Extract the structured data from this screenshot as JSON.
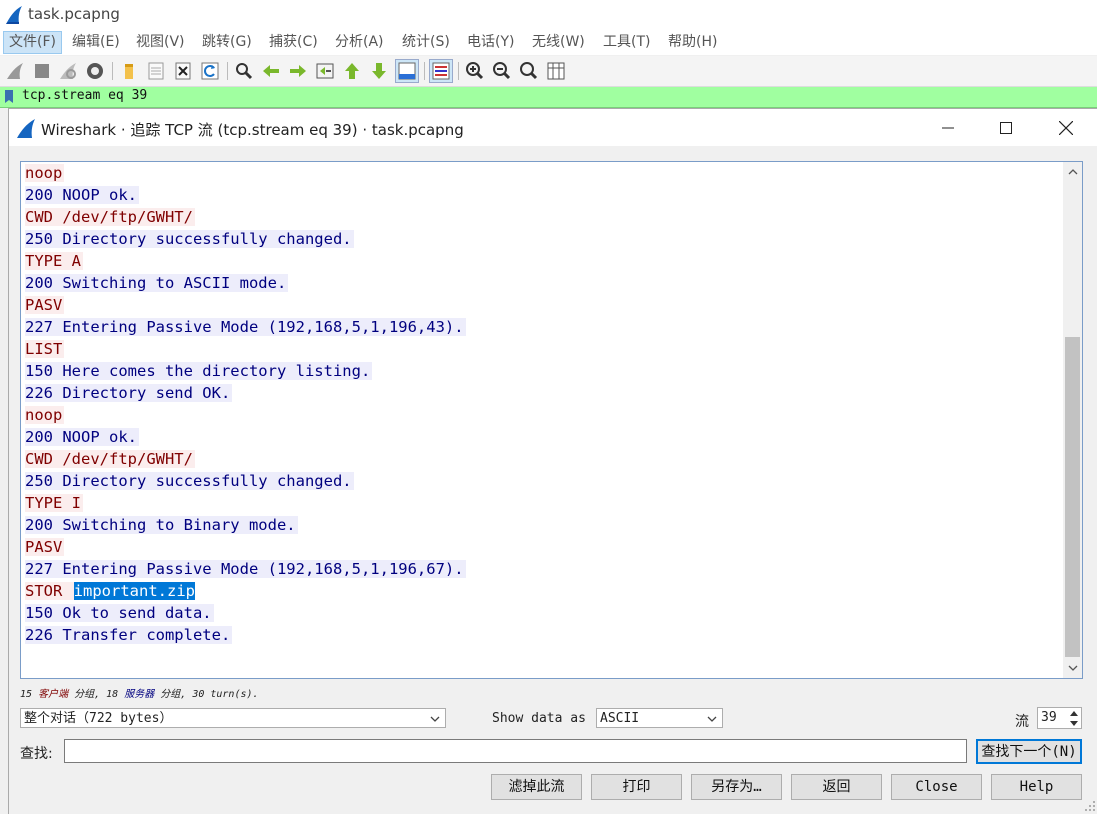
{
  "app": {
    "file_title": "task.pcapng",
    "menu": [
      "文件(F)",
      "编辑(E)",
      "视图(V)",
      "跳转(G)",
      "捕获(C)",
      "分析(A)",
      "统计(S)",
      "电话(Y)",
      "无线(W)",
      "工具(T)",
      "帮助(H)"
    ],
    "display_filter": "tcp.stream eq 39"
  },
  "dialog": {
    "title": "Wireshark · 追踪 TCP 流 (tcp.stream eq 39) · task.pcapng",
    "lines": [
      {
        "dir": "client",
        "text": "noop"
      },
      {
        "dir": "server",
        "text": "200 NOOP ok."
      },
      {
        "dir": "client",
        "text": "CWD /dev/ftp/GWHT/"
      },
      {
        "dir": "server",
        "text": "250 Directory successfully changed."
      },
      {
        "dir": "client",
        "text": "TYPE A"
      },
      {
        "dir": "server",
        "text": "200 Switching to ASCII mode."
      },
      {
        "dir": "client",
        "text": "PASV"
      },
      {
        "dir": "server",
        "text": "227 Entering Passive Mode (192,168,5,1,196,43)."
      },
      {
        "dir": "client",
        "text": "LIST"
      },
      {
        "dir": "server",
        "text": "150 Here comes the directory listing."
      },
      {
        "dir": "server",
        "text": "226 Directory send OK."
      },
      {
        "dir": "client",
        "text": "noop"
      },
      {
        "dir": "server",
        "text": "200 NOOP ok."
      },
      {
        "dir": "client",
        "text": "CWD /dev/ftp/GWHT/"
      },
      {
        "dir": "server",
        "text": "250 Directory successfully changed."
      },
      {
        "dir": "client",
        "text": "TYPE I"
      },
      {
        "dir": "server",
        "text": "200 Switching to Binary mode."
      },
      {
        "dir": "client",
        "text": "PASV"
      },
      {
        "dir": "server",
        "text": "227 Entering Passive Mode (192,168,5,1,196,67)."
      },
      {
        "dir": "client",
        "text": "STOR ",
        "highlight": "important.zip"
      },
      {
        "dir": "server",
        "text": "150 Ok to send data."
      },
      {
        "dir": "server",
        "text": "226 Transfer complete."
      }
    ],
    "stats": {
      "client_count": "15",
      "client_label": "客户端",
      "group_word": "分组",
      "server_count": "18",
      "server_label": "服务器",
      "tail": "30 turn(s)."
    },
    "conversation_select": "整个对话（722 bytes）",
    "show_data_label": "Show data as",
    "show_data_value": "ASCII",
    "stream_label": "流",
    "stream_value": "39",
    "find_label": "查找:",
    "find_value": "",
    "find_next_label": "查找下一个(N)",
    "buttons": {
      "filter_out": "滤掉此流",
      "print": "打印",
      "save_as": "另存为…",
      "back": "返回",
      "close": "Close",
      "help": "Help"
    }
  }
}
